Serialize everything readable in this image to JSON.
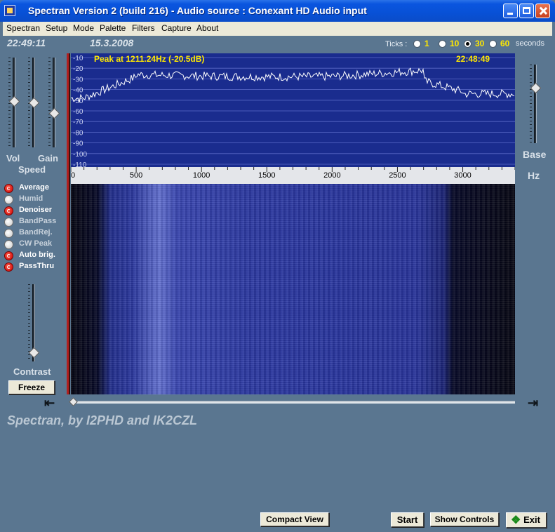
{
  "window": {
    "title": "Spectran Version 2 (build 216) - Audio source  :  Conexant HD Audio input"
  },
  "menu": [
    "Spectran",
    "Setup",
    "Mode",
    "Palette",
    "Filters",
    "Capture",
    "About"
  ],
  "status": {
    "time": "22:49:11",
    "date": "15.3.2008"
  },
  "ticks": {
    "label": "Ticks :",
    "options": [
      "1",
      "10",
      "30",
      "60"
    ],
    "selected": "30",
    "unit": "seconds"
  },
  "left_panel": {
    "vol_label": "Vol",
    "gain_label": "Gain",
    "speed_label": "Speed",
    "contrast_label": "Contrast",
    "freeze_label": "Freeze",
    "toggles": [
      {
        "label": "Average",
        "on": true
      },
      {
        "label": "Humid",
        "on": false
      },
      {
        "label": "Denoiser",
        "on": true
      },
      {
        "label": "BandPass",
        "on": false
      },
      {
        "label": "BandRej.",
        "on": false
      },
      {
        "label": "CW Peak",
        "on": false
      },
      {
        "label": "Auto brig.",
        "on": true
      },
      {
        "label": "PassThru",
        "on": true
      }
    ]
  },
  "right_panel": {
    "base_label": "Base",
    "hz_label": "Hz"
  },
  "spectrum": {
    "peak_text": "Peak at  1211.24Hz (-20.5dB)",
    "time_text": "22:48:49",
    "db_ticks": [
      "-10",
      "-20",
      "-30",
      "-40",
      "-50",
      "-60",
      "-70",
      "-80",
      "-90",
      "-100",
      "-110"
    ],
    "freq_ticks": [
      "0",
      "500",
      "1000",
      "1500",
      "2000",
      "2500",
      "3000"
    ]
  },
  "credits": "Spectran, by I2PHD and IK2CZL",
  "buttons": {
    "compact_view": "Compact View",
    "start": "Start",
    "show_controls": "Show Controls",
    "exit": "Exit"
  },
  "colors": {
    "plot_bg": "#1a2c8e",
    "grid": "#5a6ac8",
    "trace": "#ffffff",
    "peak_text": "#ffe800",
    "panel_bg": "#5a7690"
  }
}
